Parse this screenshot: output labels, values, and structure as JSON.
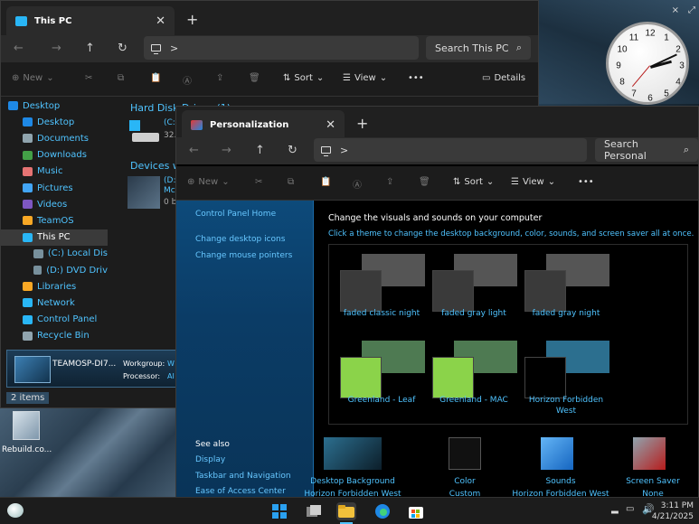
{
  "desktop": {
    "shortcut_label": "Rebuild.co..."
  },
  "clock": {
    "numbers": [
      "12",
      "1",
      "2",
      "3",
      "4",
      "5",
      "6",
      "7",
      "8",
      "9",
      "10",
      "11"
    ],
    "close_glyph": "×",
    "expand_glyph": "⤢"
  },
  "explorer": {
    "tab_title": "This PC",
    "close_glyph": "✕",
    "new_tab_glyph": "+",
    "search_placeholder": "Search This PC",
    "breadcrumb_chevron": ">",
    "toolbar": {
      "new_label": "New",
      "sort_label": "Sort",
      "view_label": "View",
      "more_label": "•••",
      "details_label": "Details"
    },
    "sidebar": [
      {
        "label": "Desktop",
        "color": "#1e88e5"
      },
      {
        "label": "Desktop",
        "color": "#1e88e5"
      },
      {
        "label": "Documents",
        "color": "#90a4ae"
      },
      {
        "label": "Downloads",
        "color": "#43a047"
      },
      {
        "label": "Music",
        "color": "#e57373"
      },
      {
        "label": "Pictures",
        "color": "#42a5f5"
      },
      {
        "label": "Videos",
        "color": "#7e57c2"
      },
      {
        "label": "TeamOS",
        "color": "#f9a825"
      },
      {
        "label": "This PC",
        "color": "#29b6f6"
      },
      {
        "label": "(C:) Local Dis",
        "color": "#78909c"
      },
      {
        "label": "(D:) DVD Driv",
        "color": "#78909c"
      },
      {
        "label": "Libraries",
        "color": "#f9a825"
      },
      {
        "label": "Network",
        "color": "#29b6f6"
      },
      {
        "label": "Control Panel",
        "color": "#29b6f6"
      },
      {
        "label": "Recycle Bin",
        "color": "#90a4ae"
      }
    ],
    "section_hard_disk": "Hard Disk Drives (1)",
    "section_devices": "Devices w",
    "drive_c_label": "(C:",
    "drive_c_size": "32.",
    "dvd_label": "(D:",
    "dvd_label2": "Mc",
    "dvd_size": "0 b",
    "details_pane": {
      "computer_name": "TEAMOSP-DI7...",
      "workgroup_label": "Workgroup:",
      "workgroup_value": "W",
      "processor_label": "Processor:",
      "processor_value": "AI"
    },
    "status_items": "2 items"
  },
  "personalization": {
    "tab_title": "Personalization",
    "close_glyph": "✕",
    "new_tab_glyph": "+",
    "search_placeholder": "Search Personal",
    "breadcrumb_chevron": ">",
    "toolbar": {
      "new_label": "New",
      "sort_label": "Sort",
      "view_label": "View",
      "more_label": "•••"
    },
    "left_links": {
      "home": "Control Panel Home",
      "desktop_icons": "Change desktop icons",
      "mouse_pointers": "Change mouse pointers",
      "see_also": "See also",
      "display": "Display",
      "taskbar": "Taskbar and Navigation",
      "ease": "Ease of Access Center"
    },
    "heading": "Change the visuals and sounds on your computer",
    "subheading": "Click a theme to change the desktop background, color, sounds, and screen saver all at once.",
    "themes": [
      {
        "name": "faded classic night",
        "front": "#3a3a3a",
        "back": "#555555"
      },
      {
        "name": "faded gray light",
        "front": "#3a3a3a",
        "back": "#555555"
      },
      {
        "name": "faded gray night",
        "front": "#3a3a3a",
        "back": "#555555"
      },
      {
        "name": "Greenland - Leaf",
        "front": "#8bd34a",
        "back": "#4e7a52"
      },
      {
        "name": "Greenland - MAC",
        "front": "#8bd34a",
        "back": "#4e7a52"
      },
      {
        "name": "Horizon Forbidden West",
        "front": "#000000",
        "back": "#2c6f8f"
      }
    ],
    "bottom": [
      {
        "label": "Desktop Background",
        "value": "Horizon Forbidden West"
      },
      {
        "label": "Color",
        "value": "Custom"
      },
      {
        "label": "Sounds",
        "value": "Horizon Forbidden West"
      },
      {
        "label": "Screen Saver",
        "value": "None"
      }
    ]
  },
  "taskbar": {
    "time": "3:11 PM",
    "date": "4/21/2025"
  }
}
